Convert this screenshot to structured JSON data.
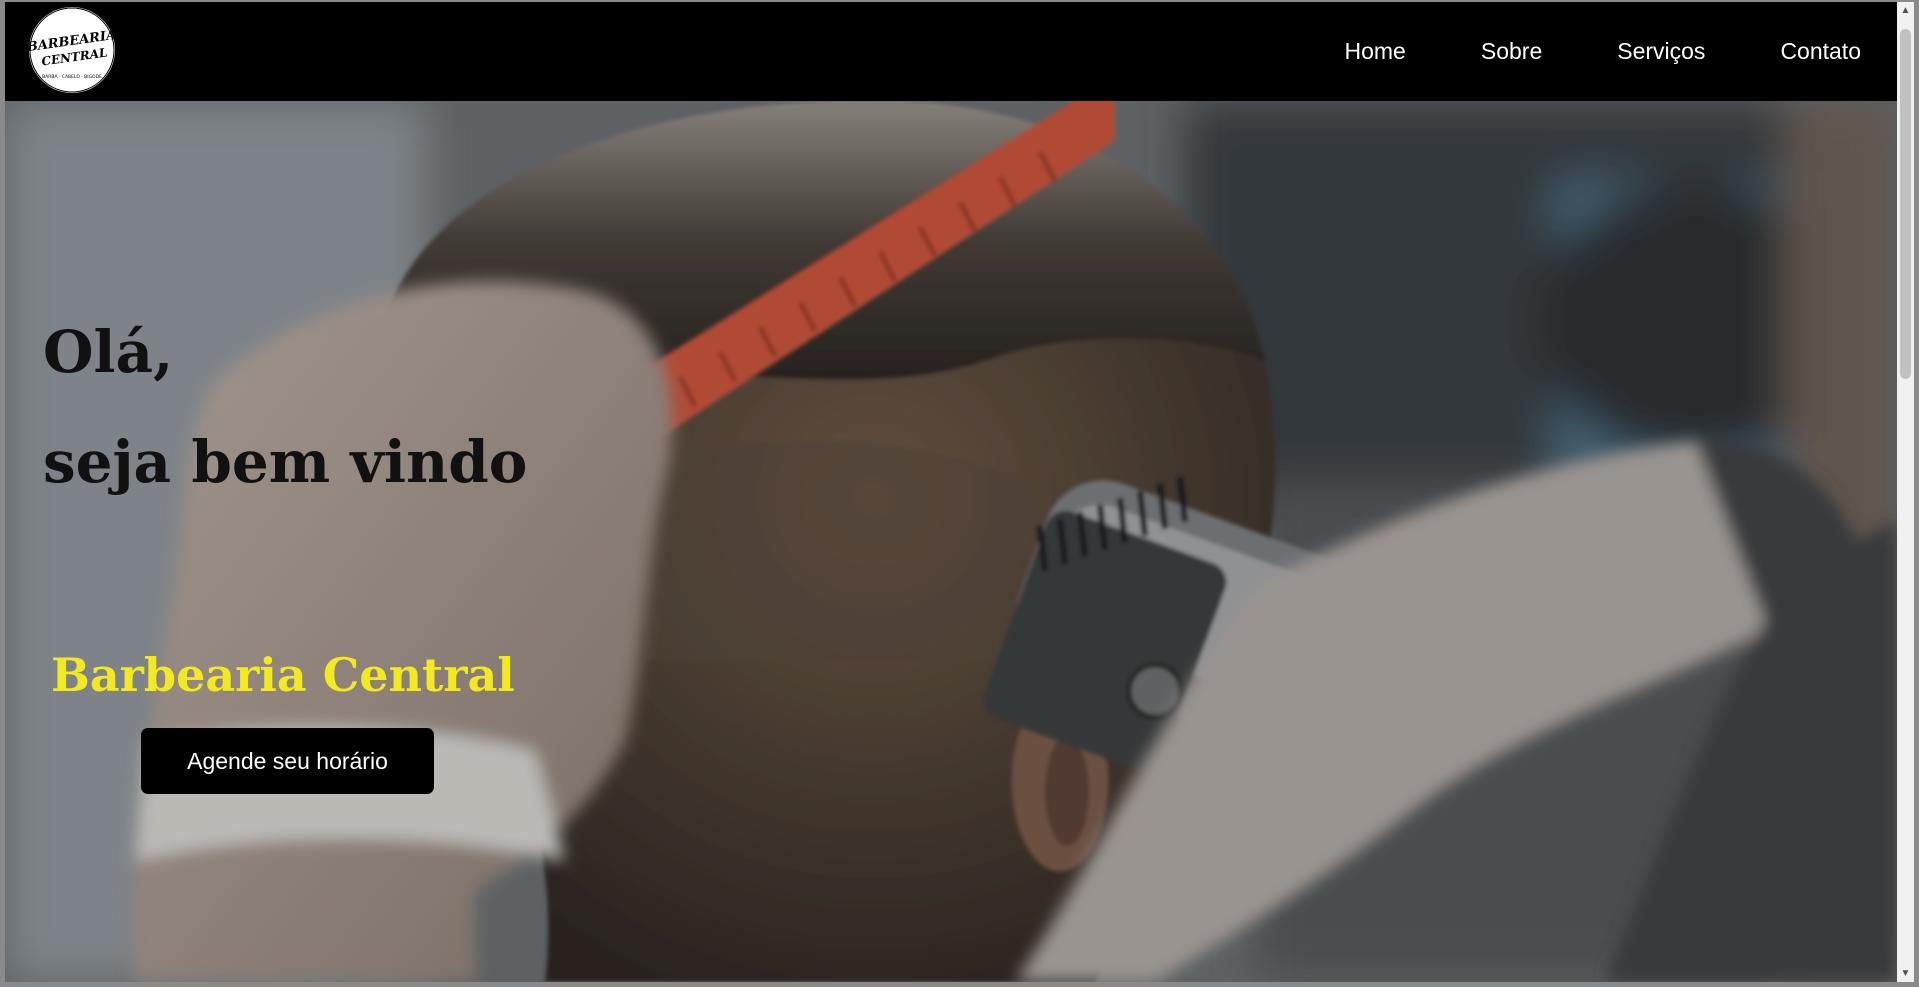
{
  "header": {
    "logo": {
      "line1": "BARBEARIA",
      "line2": "CENTRAL",
      "tagline": "BARBA · CABELO · BIGODE"
    },
    "nav": [
      {
        "label": "Home"
      },
      {
        "label": "Sobre"
      },
      {
        "label": "Serviços"
      },
      {
        "label": "Contato"
      }
    ]
  },
  "hero": {
    "greeting_line1": "Olá,",
    "greeting_line2": "seja bem vindo",
    "brand_name": "Barbearia Central",
    "cta_label": "Agende seu horário",
    "image_icon": "barber-haircut-photo"
  },
  "colors": {
    "header_bg": "#000000",
    "brand_accent": "#f2ea1e",
    "cta_bg": "#000000",
    "cta_text": "#ffffff"
  },
  "scrollbar": {
    "up_icon": "arrow-up-icon",
    "down_icon": "arrow-down-icon"
  }
}
